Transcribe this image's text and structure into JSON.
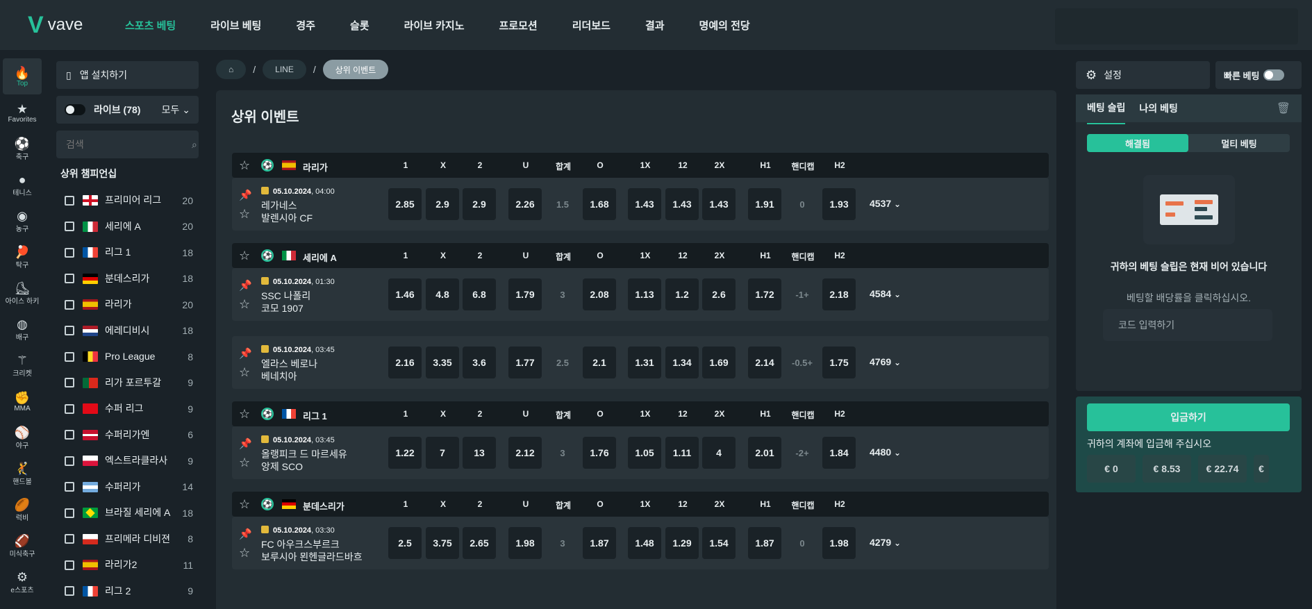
{
  "logo": {
    "mark": "V",
    "text": "vave"
  },
  "nav": [
    "스포츠 베팅",
    "라이브 베팅",
    "경주",
    "슬롯",
    "라이브 카지노",
    "프로모션",
    "리더보드",
    "결과",
    "명예의 전당"
  ],
  "rail": [
    {
      "icon": "🔥",
      "label": "Top"
    },
    {
      "icon": "★",
      "label": "Favorites"
    },
    {
      "icon": "⚽",
      "label": "축구"
    },
    {
      "icon": "●",
      "label": "테니스"
    },
    {
      "icon": "◉",
      "label": "농구"
    },
    {
      "icon": "🏓",
      "label": "탁구"
    },
    {
      "icon": "⛸",
      "label": "아이스 하키"
    },
    {
      "icon": "◍",
      "label": "배구"
    },
    {
      "icon": "⚚",
      "label": "크리켓"
    },
    {
      "icon": "✊",
      "label": "MMA"
    },
    {
      "icon": "⚾",
      "label": "야구"
    },
    {
      "icon": "🤾",
      "label": "핸드볼"
    },
    {
      "icon": "🏉",
      "label": "럭비"
    },
    {
      "icon": "🏈",
      "label": "미식축구"
    },
    {
      "icon": "⚙",
      "label": "e스포츠"
    }
  ],
  "sidebar": {
    "app_install": "앱 설치하기",
    "live_label": "라이브 (78)",
    "all_label": "모두",
    "search_placeholder": "검색",
    "section_title": "상위 챔피언십",
    "championships": [
      {
        "name": "프리미어 리그",
        "count": "20"
      },
      {
        "name": "세리에 A",
        "count": "20"
      },
      {
        "name": "리그 1",
        "count": "18"
      },
      {
        "name": "분데스리가",
        "count": "18"
      },
      {
        "name": "라리가",
        "count": "20"
      },
      {
        "name": "에레디비시",
        "count": "18"
      },
      {
        "name": "Pro League",
        "count": "8"
      },
      {
        "name": "리가 포르투갈",
        "count": "9"
      },
      {
        "name": "수퍼 리그",
        "count": "9"
      },
      {
        "name": "수퍼리가엔",
        "count": "6"
      },
      {
        "name": "엑스트라클라사",
        "count": "9"
      },
      {
        "name": "수퍼리가",
        "count": "14"
      },
      {
        "name": "브라질 세리에 A",
        "count": "18"
      },
      {
        "name": "프리메라 디비젼",
        "count": "8"
      },
      {
        "name": "라리가2",
        "count": "11"
      },
      {
        "name": "리그 2",
        "count": "9"
      }
    ]
  },
  "breadcrumb": {
    "home": "⌂",
    "line": "LINE",
    "current": "상위 이벤트",
    "sep": "/"
  },
  "main_title": "상위 이벤트",
  "columns": [
    "1",
    "X",
    "2",
    "U",
    "합계",
    "O",
    "1X",
    "12",
    "2X",
    "H1",
    "핸디캡",
    "H2"
  ],
  "leagues": [
    {
      "name": "라리가",
      "matches": [
        {
          "date": "05.10.2024",
          "time": ", 04:00",
          "team1": "레가네스",
          "team2": "발렌시아 CF",
          "odds": [
            "2.85",
            "2.9",
            "2.9",
            "2.26",
            "1.5",
            "1.68",
            "1.43",
            "1.43",
            "1.43",
            "1.91",
            "0",
            "1.93"
          ],
          "more": "4537"
        }
      ]
    },
    {
      "name": "세리에 A",
      "matches": [
        {
          "date": "05.10.2024",
          "time": ", 01:30",
          "team1": "SSC 나폴리",
          "team2": "코모 1907",
          "odds": [
            "1.46",
            "4.8",
            "6.8",
            "1.79",
            "3",
            "2.08",
            "1.13",
            "1.2",
            "2.6",
            "1.72",
            "-1+",
            "2.18"
          ],
          "more": "4584"
        },
        {
          "date": "05.10.2024",
          "time": ", 03:45",
          "team1": "엘라스 베로나",
          "team2": "베네치아",
          "odds": [
            "2.16",
            "3.35",
            "3.6",
            "1.77",
            "2.5",
            "2.1",
            "1.31",
            "1.34",
            "1.69",
            "2.14",
            "-0.5+",
            "1.75"
          ],
          "more": "4769"
        }
      ]
    },
    {
      "name": "리그 1",
      "matches": [
        {
          "date": "05.10.2024",
          "time": ", 03:45",
          "team1": "올랭피크 드 마르세유",
          "team2": "앙제 SCO",
          "odds": [
            "1.22",
            "7",
            "13",
            "2.12",
            "3",
            "1.76",
            "1.05",
            "1.11",
            "4",
            "2.01",
            "-2+",
            "1.84"
          ],
          "more": "4480"
        }
      ]
    },
    {
      "name": "분데스리가",
      "matches": [
        {
          "date": "05.10.2024",
          "time": ", 03:30",
          "team1": "FC 아우크스부르크",
          "team2": "보루시아 묀헨글라드바흐",
          "odds": [
            "2.5",
            "3.75",
            "2.65",
            "1.98",
            "3",
            "1.87",
            "1.48",
            "1.29",
            "1.54",
            "1.87",
            "0",
            "1.98"
          ],
          "more": "4279"
        }
      ]
    }
  ],
  "betslip": {
    "settings": "설정",
    "quick_bet": "빠른 베팅",
    "tab_slip": "베팅 슬립",
    "tab_mine": "나의 베팅",
    "seg_single": "해결됨",
    "seg_multi": "멀티 베팅",
    "empty": "귀하의 베팅 슬립은 현재 비어 있습니다",
    "hint": "베팅할 배당률을 클릭하십시오.",
    "code_placeholder": "코드 입력하기",
    "deposit_button": "입금하기",
    "deposit_text": "귀하의 계좌에 입금해 주십시오",
    "amounts": [
      "€ 0",
      "€ 8.53",
      "€ 22.74",
      "€"
    ]
  }
}
